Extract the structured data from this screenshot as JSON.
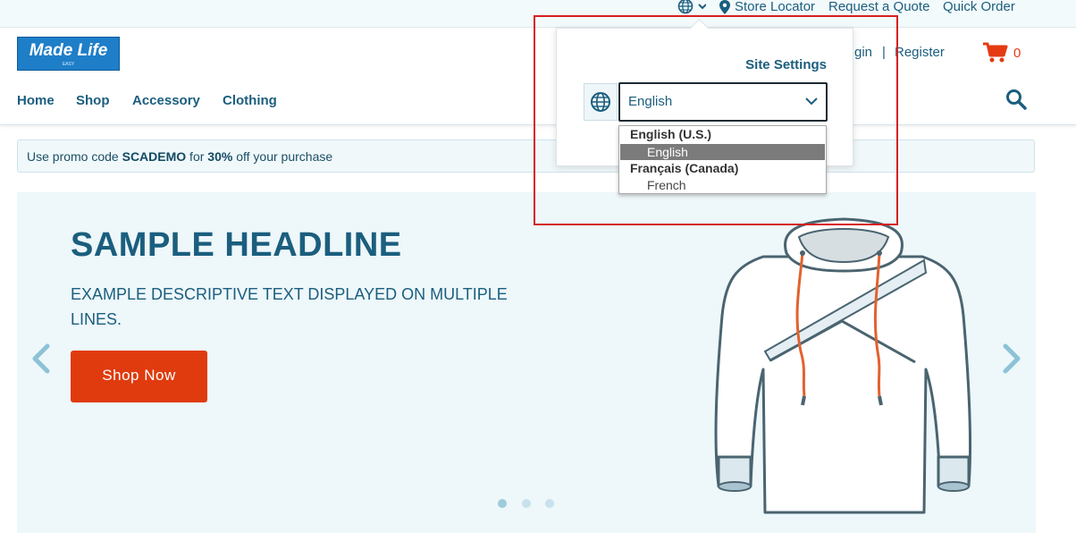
{
  "topbar": {
    "store_locator": "Store Locator",
    "request_quote": "Request a Quote",
    "quick_order": "Quick Order",
    "icons": [
      "globe-icon",
      "chevron-down-icon",
      "map-pin-icon"
    ]
  },
  "header": {
    "logo_text": "Made Life",
    "logo_sub": "EASY",
    "login": "gin",
    "separator": "|",
    "register": "Register",
    "cart_count": "0",
    "nav": [
      "Home",
      "Shop",
      "Accessory",
      "Clothing"
    ],
    "icons": [
      "cart-icon",
      "search-icon"
    ]
  },
  "promo": {
    "prefix": "Use promo code ",
    "code": "SCADEMO",
    "middle": " for ",
    "discount": "30%",
    "suffix": " off your purchase"
  },
  "hero": {
    "headline": "SAMPLE HEADLINE",
    "description": "EXAMPLE DESCRIPTIVE TEXT DISPLAYED ON MULTIPLE LINES.",
    "button_label": "Shop Now",
    "slide_count": 3,
    "active_slide": 1,
    "icons": [
      "chevron-left-icon",
      "chevron-right-icon",
      "hoodie-image"
    ]
  },
  "site_settings": {
    "title": "Site Settings",
    "language_selected": "English",
    "options": {
      "group1": "English (U.S.)",
      "opt1": "English",
      "group2": "Français (Canada)",
      "opt2": "French"
    }
  },
  "colors": {
    "primary": "#1b5e7e",
    "accent": "#e03b0e",
    "highlight": "#d6201f",
    "selected_option": "#7b7b7b"
  }
}
